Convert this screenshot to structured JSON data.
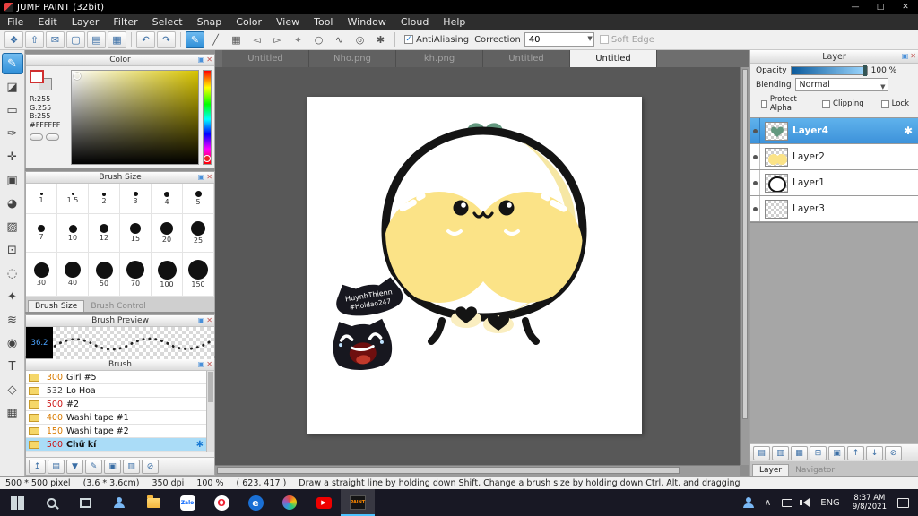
{
  "window": {
    "title": "JUMP PAINT (32bit)",
    "minimize": "—",
    "maximize": "□",
    "close": "✕"
  },
  "menubar": {
    "items": [
      "File",
      "Edit",
      "Layer",
      "Filter",
      "Select",
      "Snap",
      "Color",
      "View",
      "Tool",
      "Window",
      "Cloud",
      "Help"
    ]
  },
  "toolbar": {
    "icons": [
      "❖",
      "⇧",
      "✉",
      "▢",
      "▤",
      "▦"
    ],
    "undo": "↶",
    "redo": "↷",
    "brush_tool": "✎",
    "draw_icons": [
      "╱",
      "▦",
      "◅",
      "▻",
      "⌖",
      "○",
      "∿",
      "◎",
      "✱"
    ],
    "antialiasing_label": "AntiAliasing",
    "correction_label": "Correction",
    "correction_value": "40",
    "soft_edge_label": "Soft Edge"
  },
  "tool_column": {
    "tools": [
      "✎",
      "◪",
      "▭",
      "✑",
      "✛",
      "▣",
      "◕",
      "▨",
      "⊡",
      "◌",
      "✦",
      "≋",
      "◉",
      "T",
      "◇",
      "▦"
    ]
  },
  "color_panel": {
    "title": "Color",
    "r": "R:255",
    "g": "G:255",
    "b": "B:255",
    "hex": "#FFFFFF"
  },
  "brush_size_panel": {
    "title": "Brush Size",
    "sizes": [
      "1",
      "1.5",
      "2",
      "3",
      "4",
      "5",
      "7",
      "10",
      "12",
      "15",
      "20",
      "25",
      "30",
      "40",
      "50",
      "70",
      "100",
      "150"
    ],
    "tab_active": "Brush Size",
    "tab_inactive": "Brush Control"
  },
  "brush_preview_panel": {
    "title": "Brush Preview",
    "size_value": "36.2"
  },
  "brush_panel": {
    "title": "Brush",
    "gear": "✱",
    "bottom_icons": [
      "↥",
      "▤",
      "▼",
      "✎",
      "▣",
      "▥",
      "⊘"
    ],
    "items": [
      {
        "size": "300",
        "name": "Girl #5",
        "color": "#d97b00"
      },
      {
        "size": "532",
        "name": "Lo Hoa",
        "color": "#444444"
      },
      {
        "size": "500",
        "name": "#2",
        "color": "#cc1111"
      },
      {
        "size": "400",
        "name": "Washi tape #1",
        "color": "#d97b00"
      },
      {
        "size": "150",
        "name": "Washi tape #2",
        "color": "#d97b00"
      },
      {
        "size": "500",
        "name": "Chữ kí",
        "color": "#cc1111"
      }
    ]
  },
  "doc_tabs": {
    "items": [
      "Untitled",
      "Nho.png",
      "kh.png",
      "Untitled",
      "Untitled"
    ]
  },
  "canvas": {
    "sticker_line1": "HuynhThienn",
    "sticker_line2": "#Holdao247"
  },
  "layer_panel": {
    "title": "Layer",
    "opacity_label": "Opacity",
    "opacity_value": "100 %",
    "blending_label": "Blending",
    "blending_value": "Normal",
    "protect_alpha_label": "Protect Alpha",
    "clipping_label": "Clipping",
    "lock_label": "Lock",
    "gear": "✱",
    "layers": [
      {
        "name": "Layer4"
      },
      {
        "name": "Layer2"
      },
      {
        "name": "Layer1"
      },
      {
        "name": "Layer3"
      }
    ],
    "bottom_icons": [
      "▤",
      "▥",
      "▦",
      "⊞",
      "▣",
      "↑",
      "↓",
      "⊘"
    ],
    "tab_layer": "Layer",
    "tab_navigator": "Navigator"
  },
  "status_bar": {
    "pixel": "500 * 500 pixel",
    "cm": "(3.6 * 3.6cm)",
    "dpi": "350 dpi",
    "zoom": "100 %",
    "coords": "( 623, 417 )",
    "hint": "Draw a straight line by holding down Shift, Change a brush size by holding down Ctrl, Alt, and dragging"
  },
  "taskbar": {
    "zalo": "Zalo",
    "opera": "O",
    "edge": "e",
    "play": "▶",
    "paint": "PAINT",
    "chevron": "∧",
    "lang": "ENG",
    "time": "8:37 AM",
    "date": "9/8/2021"
  },
  "colors": {
    "accent_blue": "#2f8fd8",
    "selected_layer": "#3d92da",
    "brush_selected_bg": "#aadcf7"
  }
}
